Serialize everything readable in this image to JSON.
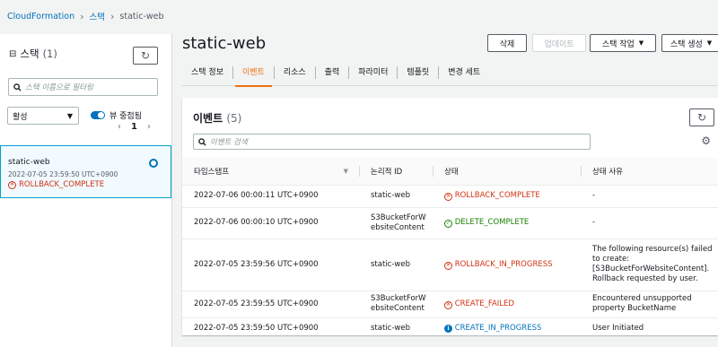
{
  "breadcrumb": {
    "root": "CloudFormation",
    "section": "스택",
    "current": "static-web"
  },
  "sidebar": {
    "title": "스택",
    "count": "(1)",
    "search_placeholder": "스택 이름으로 필터링",
    "filter_value": "활성",
    "nested_view_label": "뷰 중첩됨",
    "page": "1",
    "stacks": [
      {
        "name": "static-web",
        "created": "2022-07-05 23:59:50 UTC+0900",
        "status": "ROLLBACK_COMPLETE"
      }
    ]
  },
  "main": {
    "title": "static-web",
    "buttons": {
      "delete": "삭제",
      "update": "업데이트",
      "stack_actions": "스택 작업",
      "create_stack": "스택 생성"
    },
    "tabs": [
      "스택 정보",
      "이벤트",
      "리소스",
      "출력",
      "파라미터",
      "템플릿",
      "변경 세트"
    ],
    "active_tab": "이벤트"
  },
  "events": {
    "title": "이벤트",
    "count": "(5)",
    "search_placeholder": "이벤트 검색",
    "columns": [
      "타임스탬프",
      "논리적 ID",
      "상태",
      "상태 사유"
    ],
    "rows": [
      {
        "timestamp": "2022-07-06 00:00:11 UTC+0900",
        "logical_id": "static-web",
        "status": "ROLLBACK_COMPLETE",
        "status_type": "fail",
        "reason": "-"
      },
      {
        "timestamp": "2022-07-06 00:00:10 UTC+0900",
        "logical_id": "S3BucketForWebsiteContent",
        "status": "DELETE_COMPLETE",
        "status_type": "ok",
        "reason": "-"
      },
      {
        "timestamp": "2022-07-05 23:59:56 UTC+0900",
        "logical_id": "static-web",
        "status": "ROLLBACK_IN_PROGRESS",
        "status_type": "fail",
        "reason": "The following resource(s) failed to create: [S3BucketForWebsiteContent]. Rollback requested by user."
      },
      {
        "timestamp": "2022-07-05 23:59:55 UTC+0900",
        "logical_id": "S3BucketForWebsiteContent",
        "status": "CREATE_FAILED",
        "status_type": "fail",
        "reason": "Encountered unsupported property BucketName"
      },
      {
        "timestamp": "2022-07-05 23:59:50 UTC+0900",
        "logical_id": "static-web",
        "status": "CREATE_IN_PROGRESS",
        "status_type": "info",
        "reason": "User Initiated"
      }
    ]
  },
  "colors": {
    "link": "#0073bb",
    "error": "#d13212",
    "success": "#1d8102",
    "active_tab": "#ec7211"
  }
}
